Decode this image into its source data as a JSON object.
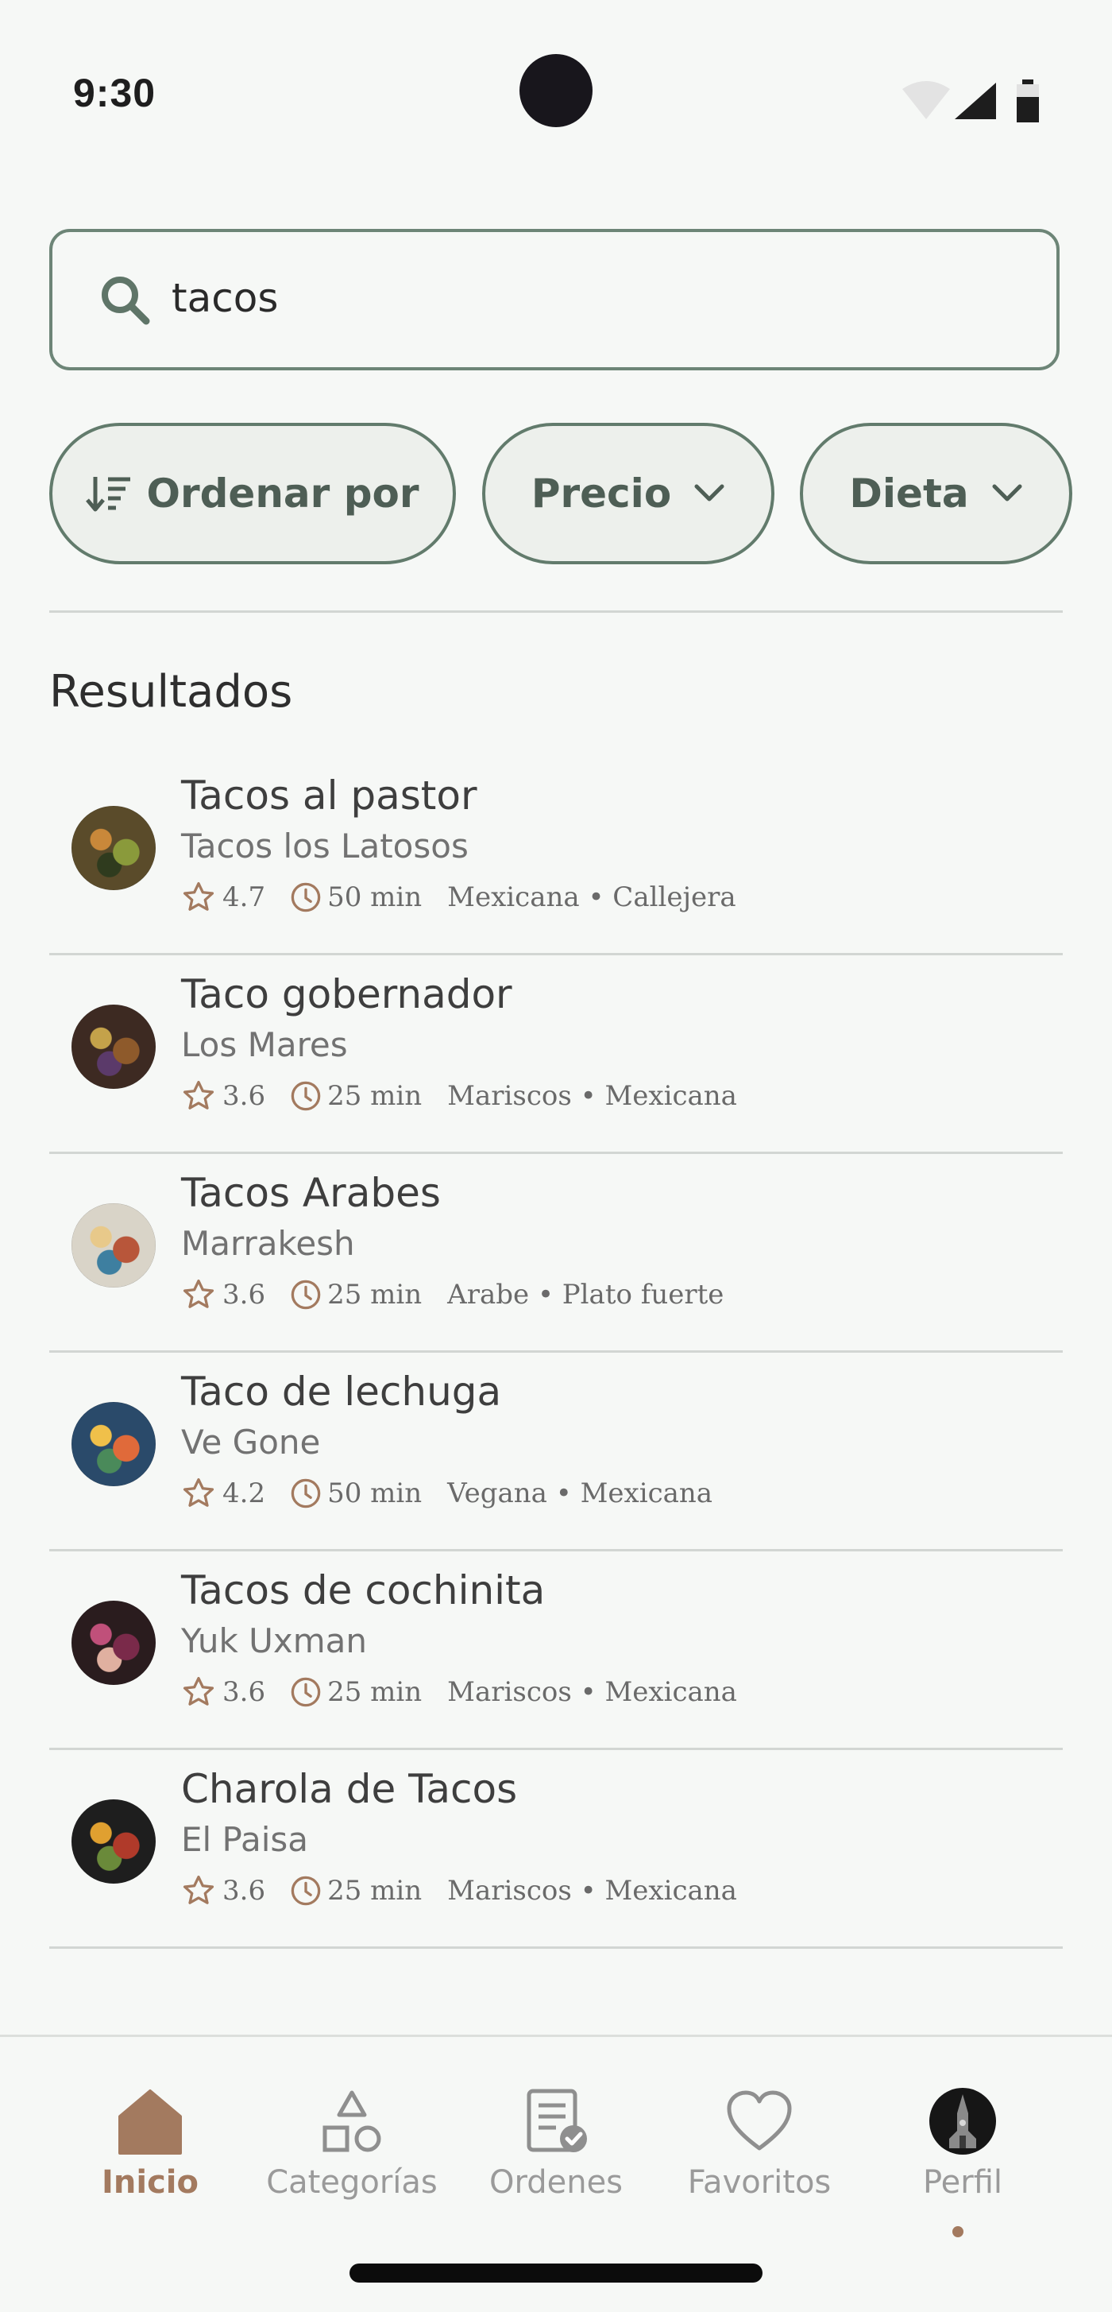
{
  "status_bar": {
    "time": "9:30"
  },
  "search": {
    "value": "tacos"
  },
  "filters": {
    "sort_label": "Ordenar por",
    "price_label": "Precio",
    "diet_label": "Dieta"
  },
  "results": {
    "title": "Resultados",
    "items": [
      {
        "dish": "Tacos al pastor",
        "restaurant": "Tacos los Latosos",
        "rating": "4.7",
        "time": "50 min",
        "tags": "Mexicana • Callejera"
      },
      {
        "dish": "Taco gobernador",
        "restaurant": "Los Mares",
        "rating": "3.6",
        "time": "25 min",
        "tags": "Mariscos • Mexicana"
      },
      {
        "dish": "Tacos Arabes",
        "restaurant": "Marrakesh",
        "rating": "3.6",
        "time": "25 min",
        "tags": "Arabe • Plato fuerte"
      },
      {
        "dish": "Taco de lechuga",
        "restaurant": "Ve Gone",
        "rating": "4.2",
        "time": "50 min",
        "tags": "Vegana • Mexicana"
      },
      {
        "dish": "Tacos de cochinita",
        "restaurant": "Yuk Uxman",
        "rating": "3.6",
        "time": "25 min",
        "tags": "Mariscos • Mexicana"
      },
      {
        "dish": "Charola de Tacos",
        "restaurant": "El Paisa",
        "rating": "3.6",
        "time": "25 min",
        "tags": "Mariscos • Mexicana"
      }
    ]
  },
  "bottom_nav": {
    "items": [
      {
        "label": "Inicio",
        "icon": "home-icon",
        "active": true
      },
      {
        "label": "Categorías",
        "icon": "categories-icon",
        "active": false
      },
      {
        "label": "Ordenes",
        "icon": "orders-icon",
        "active": false
      },
      {
        "label": "Favoritos",
        "icon": "heart-icon",
        "active": false
      },
      {
        "label": "Perfil",
        "icon": "profile-avatar",
        "active": false
      }
    ]
  },
  "colors": {
    "background": "#f6f8f6",
    "accent": "#a37a5f",
    "chip_border": "#627b6c",
    "chip_text": "#4e5e55"
  }
}
